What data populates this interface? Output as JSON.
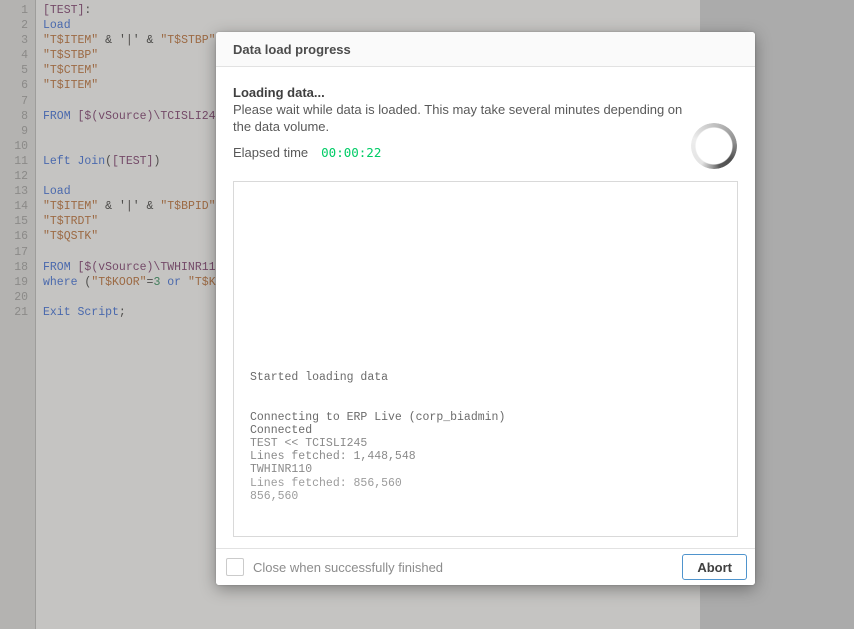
{
  "dialog": {
    "title": "Data load progress",
    "status_heading": "Loading data...",
    "status_message": "Please wait while data is loaded. This may take several minutes depending on the data volume.",
    "elapsed_label": "Elapsed time",
    "elapsed_value": "00:00:22",
    "elapsed_color": "#00cc66",
    "spinner_icon": "loading-spinner",
    "log_lines": [
      {
        "text": "Started loading data",
        "tone": "dark"
      },
      {
        "text": "",
        "tone": "mid"
      },
      {
        "text": "",
        "tone": "mid"
      },
      {
        "text": "Connecting to ERP Live (corp_biadmin)",
        "tone": "dark"
      },
      {
        "text": "Connected",
        "tone": "dark"
      },
      {
        "text": "TEST << TCISLI245",
        "tone": "mid"
      },
      {
        "text": "Lines fetched: 1,448,548",
        "tone": "mid"
      },
      {
        "text": "TWHINR110",
        "tone": "mid"
      },
      {
        "text": "Lines fetched: 856,560",
        "tone": "light"
      },
      {
        "text": "856,560",
        "tone": "light"
      }
    ],
    "log_tones": {
      "dark": "#6b6b6b",
      "mid": "#8a8a8a",
      "light": "#9c9c9c"
    },
    "footer": {
      "checkbox_label": "Close when successfully finished",
      "checkbox_checked": false,
      "abort_label": "Abort"
    }
  },
  "editor": {
    "colors": {
      "kw": "#4a69ad",
      "str": "#9c6a44",
      "tbl": "#744a68",
      "op": "#4d4c4a",
      "num": "#3f7d5a"
    },
    "lines": [
      {
        "no": "1",
        "segments": [
          {
            "t": "[TEST]",
            "c": "tbl"
          },
          {
            "t": ":",
            "c": "op"
          }
        ]
      },
      {
        "no": "2",
        "segments": [
          {
            "t": "Load",
            "c": "kw"
          }
        ]
      },
      {
        "no": "3",
        "segments": [
          {
            "t": "\"T$ITEM\"",
            "c": "str"
          },
          {
            "t": " & ",
            "c": "op"
          },
          {
            "t": "'|'",
            "c": "op"
          },
          {
            "t": " & ",
            "c": "op"
          },
          {
            "t": "\"T$STBP\"",
            "c": "str"
          }
        ]
      },
      {
        "no": "4",
        "segments": [
          {
            "t": "\"T$STBP\"",
            "c": "str"
          }
        ]
      },
      {
        "no": "5",
        "segments": [
          {
            "t": "\"T$CTEM\"",
            "c": "str"
          }
        ]
      },
      {
        "no": "6",
        "segments": [
          {
            "t": "\"T$ITEM\"",
            "c": "str"
          }
        ]
      },
      {
        "no": "7",
        "segments": []
      },
      {
        "no": "8",
        "segments": [
          {
            "t": "FROM",
            "c": "kw"
          },
          {
            "t": " ",
            "c": "op"
          },
          {
            "t": "[$(vSource)\\TCISLI24",
            "c": "tbl"
          }
        ]
      },
      {
        "no": "9",
        "segments": []
      },
      {
        "no": "10",
        "segments": []
      },
      {
        "no": "11",
        "segments": [
          {
            "t": "Left Join",
            "c": "kw"
          },
          {
            "t": "(",
            "c": "op"
          },
          {
            "t": "[TEST]",
            "c": "tbl"
          },
          {
            "t": ")",
            "c": "op"
          }
        ]
      },
      {
        "no": "12",
        "segments": []
      },
      {
        "no": "13",
        "segments": [
          {
            "t": "Load",
            "c": "kw"
          }
        ]
      },
      {
        "no": "14",
        "segments": [
          {
            "t": "\"T$ITEM\"",
            "c": "str"
          },
          {
            "t": " & ",
            "c": "op"
          },
          {
            "t": "'|'",
            "c": "op"
          },
          {
            "t": " & ",
            "c": "op"
          },
          {
            "t": "\"T$BPID\"",
            "c": "str"
          }
        ]
      },
      {
        "no": "15",
        "segments": [
          {
            "t": "\"T$TRDT\"",
            "c": "str"
          }
        ]
      },
      {
        "no": "16",
        "segments": [
          {
            "t": "\"T$QSTK\"",
            "c": "str"
          }
        ]
      },
      {
        "no": "17",
        "segments": []
      },
      {
        "no": "18",
        "segments": [
          {
            "t": "FROM",
            "c": "kw"
          },
          {
            "t": " ",
            "c": "op"
          },
          {
            "t": "[$(vSource)\\TWHINR11",
            "c": "tbl"
          }
        ]
      },
      {
        "no": "19",
        "segments": [
          {
            "t": "where",
            "c": "kw"
          },
          {
            "t": " (",
            "c": "op"
          },
          {
            "t": "\"T$KOOR\"",
            "c": "str"
          },
          {
            "t": "=",
            "c": "op"
          },
          {
            "t": "3",
            "c": "num"
          },
          {
            "t": " ",
            "c": "op"
          },
          {
            "t": "or",
            "c": "kw"
          },
          {
            "t": " ",
            "c": "op"
          },
          {
            "t": "\"T$K",
            "c": "str"
          }
        ]
      },
      {
        "no": "20",
        "segments": []
      },
      {
        "no": "21",
        "segments": [
          {
            "t": "Exit Script",
            "c": "kw"
          },
          {
            "t": ";",
            "c": "op"
          }
        ]
      }
    ]
  }
}
